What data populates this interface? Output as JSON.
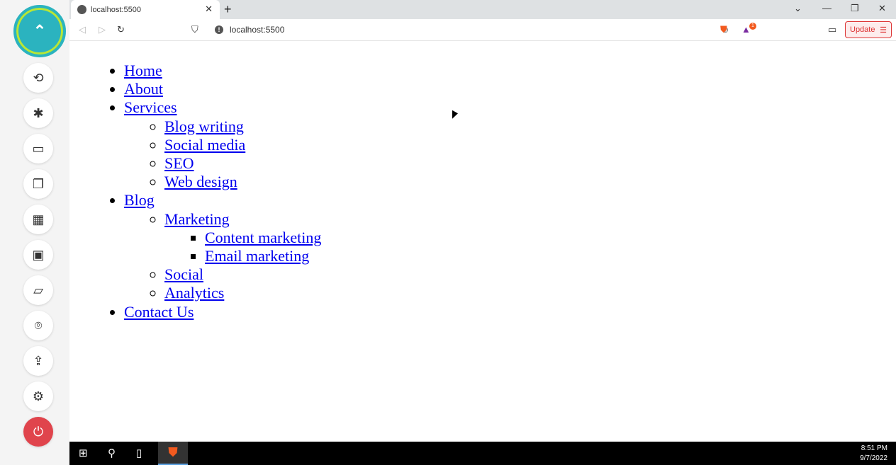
{
  "sidebar": {
    "items": [
      "chevron-up-icon",
      "sync-icon",
      "bug-icon",
      "video-icon",
      "copy-icon",
      "clipboard-icon",
      "screen-share-icon",
      "folder-icon",
      "location-icon",
      "upload-icon",
      "gear-icon",
      "power-icon"
    ]
  },
  "browser": {
    "tab_title": "localhost:5500",
    "url": "localhost:5500",
    "update_label": "Update",
    "badge_count": "1"
  },
  "nav": {
    "home": "Home",
    "about": "About",
    "services": "Services",
    "services_items": [
      "Blog writing",
      "Social media",
      "SEO",
      "Web design"
    ],
    "blog": "Blog",
    "marketing": "Marketing",
    "marketing_items": [
      "Content marketing",
      "Email marketing"
    ],
    "social": "Social",
    "analytics": "Analytics",
    "contact": "Contact Us"
  },
  "taskbar": {
    "time": "8:51 PM",
    "date": "9/7/2022"
  }
}
